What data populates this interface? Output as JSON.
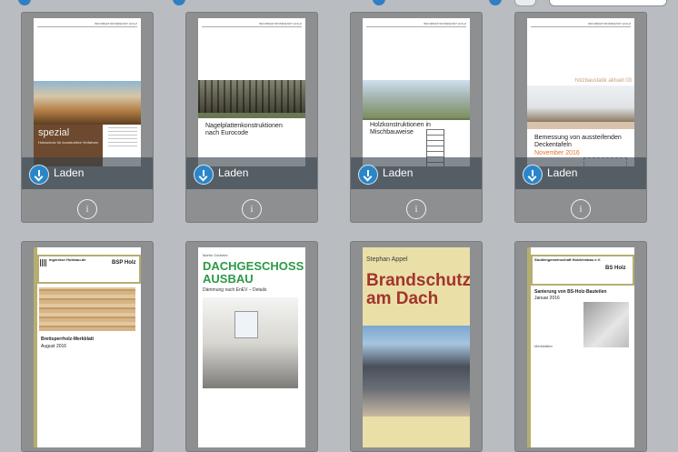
{
  "toolbar": {
    "search_placeholder": ""
  },
  "load_label": "Laden",
  "info_symbol": "i",
  "row1": [
    {
      "header": "INFORMATIONSDIENST HOLZ",
      "title": "spezial",
      "subtitle": "Holzschutz für konstruktive Verfahren",
      "action": "Laden"
    },
    {
      "header": "INFORMATIONSDIENST HOLZ",
      "title": "Nagelplattenkonstruktionen nach Eurocode",
      "action": "Laden"
    },
    {
      "header": "INFORMATIONSDIENST HOLZ",
      "title": "Holzkonstruktionen in Mischbauweise",
      "action": "Laden"
    },
    {
      "header": "INFORMATIONSDIENST HOLZ",
      "series": "holzbaustatik aktuell 03",
      "title": "Bemessung von aussteifenden Deckentafeln",
      "date": "November 2016",
      "action": "Laden"
    }
  ],
  "row2": [
    {
      "org": "Ingenieur Holzbau.de",
      "badge": "BSP Holz",
      "title": "Brettsperrholz-Merkblatt",
      "date": "August 2016"
    },
    {
      "author": "Martin Gerbeler",
      "title_line1": "DACHGESCHOSS",
      "title_line2": "AUSBAU",
      "subtitle": "Dämmung nach EnEV – Details"
    },
    {
      "author": "Stephan Appel",
      "title_line1": "Brandschutz",
      "title_line2": "am Dach"
    },
    {
      "org": "Studiengemeinschaft Holzleimbau e.V.",
      "badge": "BS Holz",
      "title": "Sanierung von BS-Holz-Bauteilen",
      "date": "Januar 2016",
      "note": "Merkblätter"
    }
  ]
}
